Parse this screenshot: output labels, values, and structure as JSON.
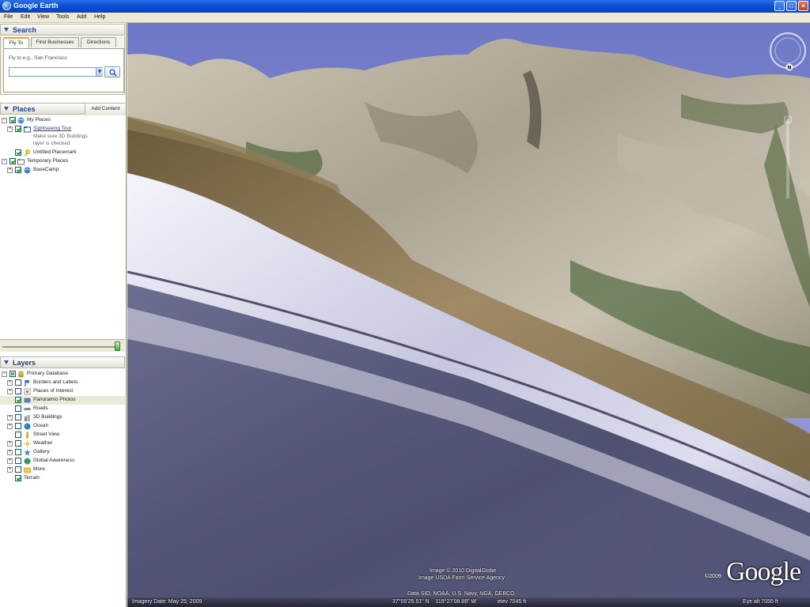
{
  "window": {
    "title": "Google Earth"
  },
  "menu": [
    "File",
    "Edit",
    "View",
    "Tools",
    "Add",
    "Help"
  ],
  "search": {
    "header": "Search",
    "tabs": [
      "Fly To",
      "Find Businesses",
      "Directions"
    ],
    "hint": "Fly to e.g., San Francisco",
    "input_value": ""
  },
  "places": {
    "header": "Places",
    "add_content": "Add Content",
    "items": [
      {
        "label": "My Places"
      },
      {
        "label": "Sightseeing Tour"
      },
      {
        "label": "Untitled Placemark"
      },
      {
        "label": "Temporary Places"
      },
      {
        "label": "BaseCamp"
      }
    ],
    "tour_note": [
      "Make sure 3D Buildings",
      "layer is checked"
    ]
  },
  "layers": {
    "header": "Layers",
    "items": [
      {
        "label": "Primary Database"
      },
      {
        "label": "Borders and Labels"
      },
      {
        "label": "Places of Interest"
      },
      {
        "label": "Panoramio Photos"
      },
      {
        "label": "Roads"
      },
      {
        "label": "3D Buildings"
      },
      {
        "label": "Ocean"
      },
      {
        "label": "Street View"
      },
      {
        "label": "Weather"
      },
      {
        "label": "Gallery"
      },
      {
        "label": "Global Awareness"
      },
      {
        "label": "More"
      },
      {
        "label": "Terrain"
      }
    ]
  },
  "view": {
    "compass_label": "N",
    "attribution": [
      "Image © 2010 DigitalGlobe",
      "Image USDA Farm Service Agency",
      "Data SIO, NOAA, U.S. Navy, NGA, GEBCO"
    ],
    "logo_text": "Google",
    "logo_copyright": "©2009",
    "status": {
      "imagery_date": "Imagery Date: May 25, 2009",
      "coords": "37°55'25.51\" N    119°27'08.88\" W",
      "elev": "elev  7045 ft",
      "eye_alt": "Eye alt   7055 ft"
    }
  },
  "colors": {
    "titlebar": "#0a4fd4",
    "sky": "#7e83c9",
    "accent": "#1c3f86"
  }
}
